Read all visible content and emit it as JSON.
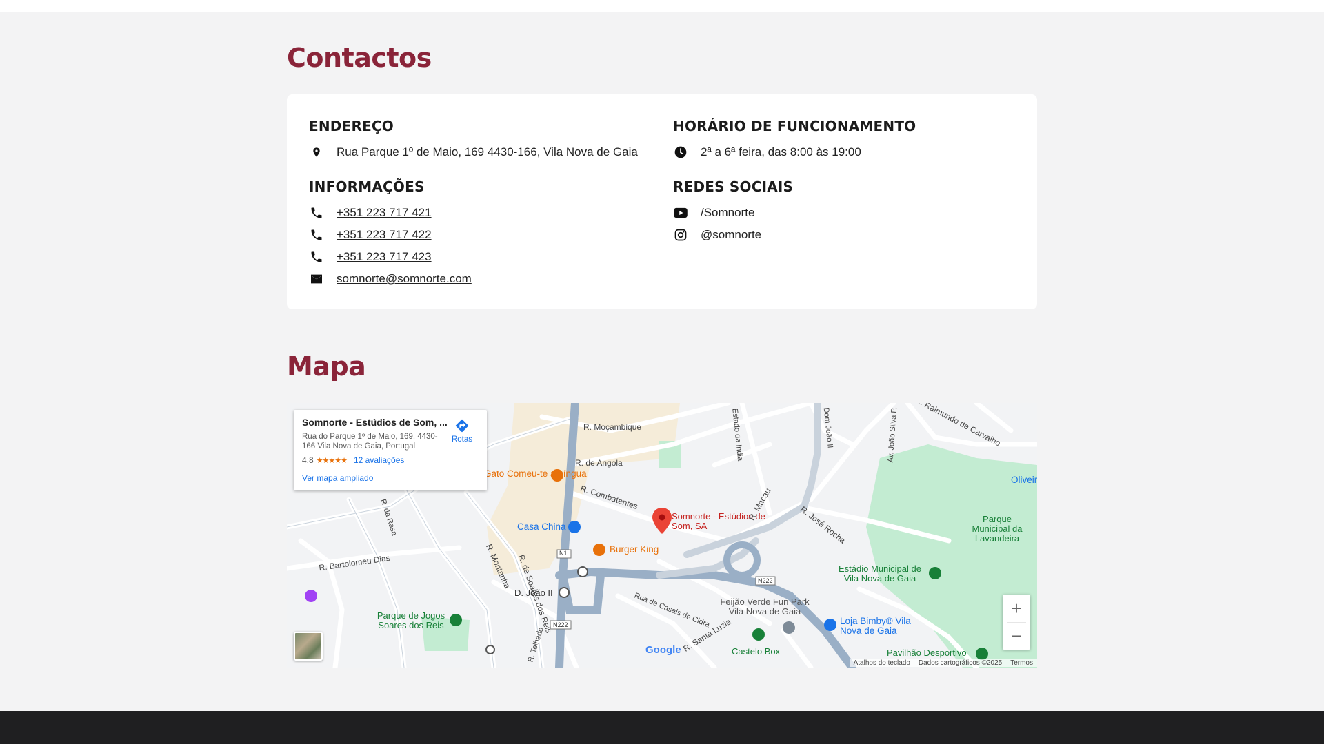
{
  "contacts": {
    "title": "Contactos",
    "address": {
      "heading": "ENDEREÇO",
      "text": "Rua Parque 1º de Maio, 169 4430-166, Vila Nova de Gaia",
      "icon": "location-pin-icon"
    },
    "hours": {
      "heading": "HORÁRIO DE FUNCIONAMENTO",
      "text": "2ª a 6ª feira, das 8:00 às 19:00",
      "icon": "clock-icon"
    },
    "info": {
      "heading": "INFORMAÇÕES",
      "phones": [
        "+351 223 717 421",
        "+351 223 717 422",
        "+351 223 717 423"
      ],
      "email": "somnorte@somnorte.com"
    },
    "social": {
      "heading": "REDES SOCIAIS",
      "youtube": "/Somnorte",
      "instagram": "@somnorte"
    }
  },
  "map": {
    "title": "Mapa",
    "infobox": {
      "name": "Somnorte - Estúdios de Som, ...",
      "address": "Rua do Parque 1º de Maio, 169, 4430-166 Vila Nova de Gaia, Portugal",
      "rating": "4,8",
      "stars": "★★★★★",
      "reviews": "12 avaliações",
      "directions": "Rotas",
      "larger_map": "Ver mapa ampliado"
    },
    "labels": {
      "r_mocambique": "R. Moçambique",
      "r_angola": "R. de Angola",
      "r_combatentes": "R. Combatentes",
      "r_macau": "R. Macau",
      "r_jose_rocha": "R. José Rocha",
      "r_bartolomeu": "R. Bartolomeu Dias",
      "r_montanha": "R. Montanha",
      "r_soares": "R. de Soares dos Reis",
      "r_casais": "Rua de Casais de Cidra",
      "r_santa_luzia": "R. Santa Luzia",
      "r_telhado": "R. Telhado",
      "r_raimundo": "R. Raimundo de Carvalho",
      "av_joao_silva": "Av. João Silva P.",
      "dom_joao": "Dom João II",
      "estado_india": "Estado da India",
      "r_rasa": "R. da Rasa",
      "d_joao": "D. João II",
      "gato": "Gato Comeu-te a Língua",
      "casa_china": "Casa China",
      "burger_king": "Burger King",
      "somnorte_pin": "Somnorte - Estúdios de Som, SA",
      "parque_jogos": "Parque de Jogos Soares dos Reis",
      "estadio": "Estádio Municipal de Vila Nova de Gaia",
      "parque_municipal": "Parque Municipal da Lavandeira",
      "feijao": "Feijão Verde Fun Park Vila Nova de Gaia",
      "loja_bimby": "Loja Bimby® Vila Nova de Gaia",
      "castelo": "Castelo Box",
      "pavilhao": "Pavilhão Desportivo",
      "oliveir": "Oliveir",
      "n1": "N1",
      "n222a": "N222",
      "n222b": "N222"
    },
    "google": "Google",
    "attribution": {
      "shortcuts": "Atalhos do teclado",
      "data": "Dados cartográficos ©2025",
      "terms": "Termos"
    },
    "zoom_in": "+",
    "zoom_out": "−"
  }
}
